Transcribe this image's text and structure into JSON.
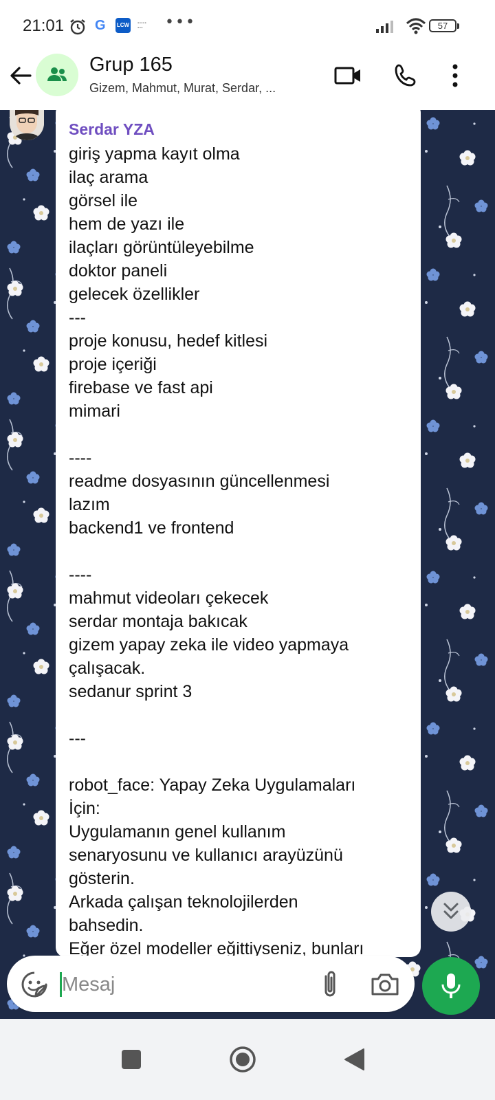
{
  "status_bar": {
    "time": "21:01",
    "notification_icons": [
      "alarm-icon",
      "google-icon",
      "lcw-app-icon",
      "brand-app-icon"
    ],
    "lcw_label": "LCW",
    "more_label": "•••",
    "battery_level": "57"
  },
  "header": {
    "title": "Grup 165",
    "subtitle": "Gizem, Mahmut, Murat, Serdar, ..."
  },
  "message": {
    "sender": "Serdar YZA",
    "text": "giriş yapma kayıt olma\nilaç arama\ngörsel ile\nhem de yazı ile\nilaçları görüntüleyebilme\ndoktor paneli\ngelecek özellikler\n---\nproje konusu, hedef kitlesi\nproje içeriği\nfirebase ve fast api\nmimari\n\n----\nreadme dosyasının güncellenmesi\nlazım\nbackend1 ve frontend\n\n----\nmahmut videoları çekecek\nserdar montaja bakıcak\ngizem yapay zeka ile video yapmaya\nçalışacak.\nsedanur sprint 3\n\n---\n\nrobot_face: Yapay Zeka Uygulamaları\nİçin:\nUygulamanın genel kullanım\nsenaryosunu ve kullanıcı arayüzünü\ngösterin.\nArkada çalışan teknolojilerden\nbahsedin.\nEğer özel modeller eğittiyseniz, bunları"
  },
  "compose": {
    "placeholder": "Mesaj"
  },
  "colors": {
    "accent": "#1da851",
    "sender_name": "#6f4ec0",
    "wallpaper": "#1e2a46",
    "avatar_bg": "#d9fdd3"
  }
}
